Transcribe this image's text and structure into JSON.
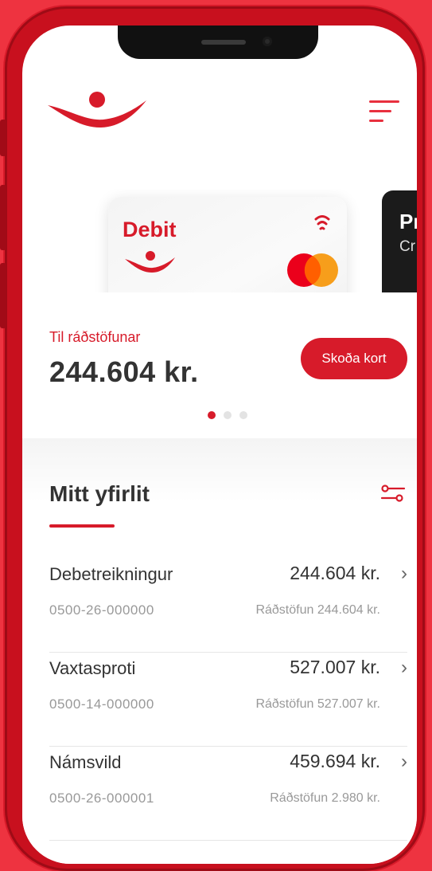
{
  "card_carousel": {
    "active_card": {
      "title": "Debit"
    },
    "next_card": {
      "title": "Pr",
      "subtitle": "Cr"
    }
  },
  "balance": {
    "label": "Til ráðstöfunar",
    "amount": "244.604 kr.",
    "button_label": "Skoða kort"
  },
  "overview": {
    "title": "Mitt yfirlit",
    "accounts": [
      {
        "name": "Debetreikningur",
        "amount": "244.604 kr.",
        "account_number": "0500-26-000000",
        "available": "Ráðstöfun 244.604 kr."
      },
      {
        "name": "Vaxtasproti",
        "amount": "527.007 kr.",
        "account_number": "0500-14-000000",
        "available": "Ráðstöfun 527.007 kr."
      },
      {
        "name": "Námsvild",
        "amount": "459.694 kr.",
        "account_number": "0500-26-000001",
        "available": "Ráðstöfun 2.980 kr."
      }
    ],
    "chevron": "›"
  },
  "colors": {
    "brand": "#d71b2a",
    "background": "#ee3340",
    "frame": "#c8101e"
  },
  "icons": [
    "brand-logo-icon",
    "menu-icon",
    "contactless-icon",
    "mastercard-icon",
    "filter-icon",
    "chevron-right-icon"
  ]
}
